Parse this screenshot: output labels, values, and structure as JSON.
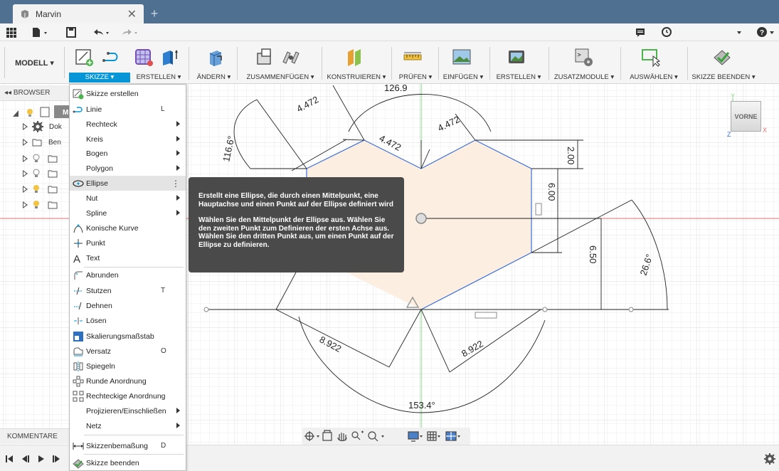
{
  "title_bar": {
    "doc_title": "Marvin",
    "close_glyph": "✕",
    "new_tab_glyph": "+"
  },
  "quick_access": {
    "grid_icon": "grid-icon",
    "file_icon": "file-icon",
    "save_icon": "save-icon",
    "undo_icon": "undo-icon",
    "redo_icon": "redo-icon",
    "comment_icon": "comment-icon",
    "clock_icon": "clock-icon",
    "help_icon": "help-icon"
  },
  "ribbon": {
    "workspace": "MODELL ▾",
    "groups": [
      {
        "label": "SKIZZE ▾",
        "active": true
      },
      {
        "label": "ERSTELLEN ▾"
      },
      {
        "label": "ÄNDERN ▾"
      },
      {
        "label": "ZUSAMMENFÜGEN ▾"
      },
      {
        "label": "KONSTRUIEREN ▾"
      },
      {
        "label": "PRÜFEN ▾"
      },
      {
        "label": "EINFÜGEN ▾"
      },
      {
        "label": "ERSTELLEN ▾"
      },
      {
        "label": "ZUSATZMODULE ▾"
      },
      {
        "label": "AUSWÄHLEN ▾"
      },
      {
        "label": "SKIZZE BEENDEN ▾"
      }
    ]
  },
  "browser": {
    "header": "◂◂  BROWSER",
    "rows": [
      {
        "label": "M"
      },
      {
        "label": "Dok"
      },
      {
        "label": "Ben"
      },
      {
        "label": ""
      },
      {
        "label": ""
      },
      {
        "label": ""
      },
      {
        "label": ""
      }
    ],
    "comments": "KOMMENTARE"
  },
  "menu": {
    "items": [
      {
        "label": "Skizze erstellen",
        "key": "",
        "sub": false,
        "icon": "sketch-create-icon"
      },
      {
        "label": "Linie",
        "key": "L",
        "sub": false,
        "icon": "line-icon"
      },
      {
        "label": "Rechteck",
        "key": "",
        "sub": true,
        "icon": ""
      },
      {
        "label": "Kreis",
        "key": "",
        "sub": true,
        "icon": ""
      },
      {
        "label": "Bogen",
        "key": "",
        "sub": true,
        "icon": ""
      },
      {
        "label": "Polygon",
        "key": "",
        "sub": true,
        "icon": ""
      },
      {
        "label": "Ellipse",
        "key": "",
        "sub": false,
        "icon": "ellipse-icon",
        "highlighted": true
      },
      {
        "label": "Nut",
        "key": "",
        "sub": true,
        "icon": ""
      },
      {
        "label": "Spline",
        "key": "",
        "sub": true,
        "icon": ""
      },
      {
        "label": "Konische Kurve",
        "key": "",
        "sub": false,
        "icon": "conic-icon"
      },
      {
        "label": "Punkt",
        "key": "",
        "sub": false,
        "icon": "point-icon"
      },
      {
        "label": "Text",
        "key": "",
        "sub": false,
        "icon": "text-icon"
      },
      {
        "label": "Abrunden",
        "key": "",
        "sub": false,
        "icon": "fillet-icon"
      },
      {
        "label": "Stutzen",
        "key": "T",
        "sub": false,
        "icon": "trim-icon"
      },
      {
        "label": "Dehnen",
        "key": "",
        "sub": false,
        "icon": "extend-icon"
      },
      {
        "label": "Lösen",
        "key": "",
        "sub": false,
        "icon": "break-icon"
      },
      {
        "label": "Skalierungsmaßstab",
        "key": "",
        "sub": false,
        "icon": "scale-icon"
      },
      {
        "label": "Versatz",
        "key": "O",
        "sub": false,
        "icon": "offset-icon"
      },
      {
        "label": "Spiegeln",
        "key": "",
        "sub": false,
        "icon": "mirror-icon"
      },
      {
        "label": "Runde Anordnung",
        "key": "",
        "sub": false,
        "icon": "circular-pattern-icon"
      },
      {
        "label": "Rechteckige Anordnung",
        "key": "",
        "sub": false,
        "icon": "rect-pattern-icon"
      },
      {
        "label": "Projizieren/Einschließen",
        "key": "",
        "sub": true,
        "icon": ""
      },
      {
        "label": "Netz",
        "key": "",
        "sub": true,
        "icon": ""
      },
      {
        "label": "Skizzenbemaßung",
        "key": "D",
        "sub": false,
        "icon": "dimension-icon"
      },
      {
        "label": "Skizze beenden",
        "key": "",
        "sub": false,
        "icon": "finish-sketch-icon"
      }
    ],
    "more_glyph": "⋮"
  },
  "tooltip": {
    "line1": "Erstellt eine Ellipse, die durch einen Mittelpunkt, eine Hauptachse und einen Punkt auf der Ellipse definiert wird",
    "line2": "Wählen Sie den Mittelpunkt der Ellipse aus. Wählen Sie den zweiten Punkt zum Definieren der ersten Achse aus. Wählen Sie den dritten Punkt aus, um einen Punkt auf der Ellipse zu definieren."
  },
  "viewcube": {
    "face": "VORNE",
    "axis_x": "X",
    "axis_y": "Y",
    "axis_z": "Z"
  },
  "dimensions": {
    "top_arc": "126.9",
    "left_arc": "116.6°",
    "d1": "4.472",
    "d2": "4.472",
    "d3": "4.472",
    "d4": "2.00",
    "d5": "6.00",
    "d6": "6.50",
    "d7": "26.6°",
    "d8": "8.922",
    "d9": "8.922",
    "bottom_arc": "153.4°"
  },
  "colors": {
    "title_bar": "#4f7090",
    "accent": "#0696d7",
    "sketch_line": "#3a6fd8",
    "sketch_fill": "#fcefe2",
    "y_axis": "#7fd87f",
    "x_axis": "#e07070"
  }
}
